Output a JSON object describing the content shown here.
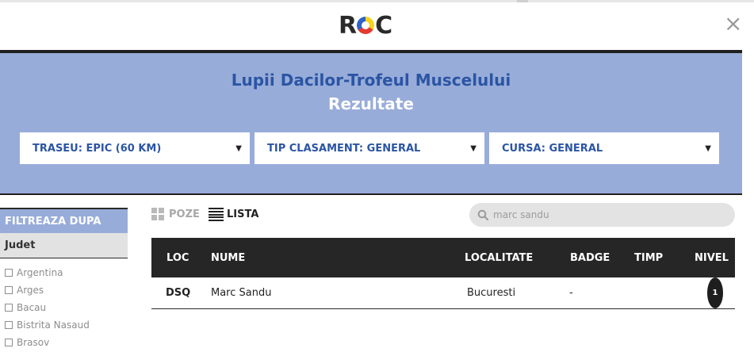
{
  "brand": {
    "logo_text_left": "R",
    "logo_text_right": "C"
  },
  "header": {
    "close_symbol": "×"
  },
  "event": {
    "title": "Lupii Dacilor-Trofeul Muscelului",
    "subtitle": "Rezultate"
  },
  "dropdowns": [
    {
      "label": "TRASEU: EPIC (60 KM)"
    },
    {
      "label": "TIP CLASAMENT: GENERAL"
    },
    {
      "label": "CURSA: GENERAL"
    }
  ],
  "filters": {
    "heading": "FILTREAZA DUPA",
    "section": "Judet",
    "counties": [
      "Argentina",
      "Arges",
      "Bacau",
      "Bistrita Nasaud",
      "Brasov"
    ]
  },
  "views": {
    "poze": "POZE",
    "lista": "LISTA"
  },
  "search": {
    "value": "marc sandu"
  },
  "table": {
    "columns": [
      "LOC",
      "NUME",
      "LOCALITATE",
      "BADGE",
      "TIMP",
      "NIVEL"
    ],
    "rows": [
      {
        "loc": "DSQ",
        "nume": "Marc Sandu",
        "localitate": "Bucuresti",
        "badge": "-",
        "timp": "",
        "nivel": "1"
      }
    ]
  },
  "colors": {
    "band": "#98acd9",
    "accent": "#2b55a4",
    "dark": "#262626"
  }
}
